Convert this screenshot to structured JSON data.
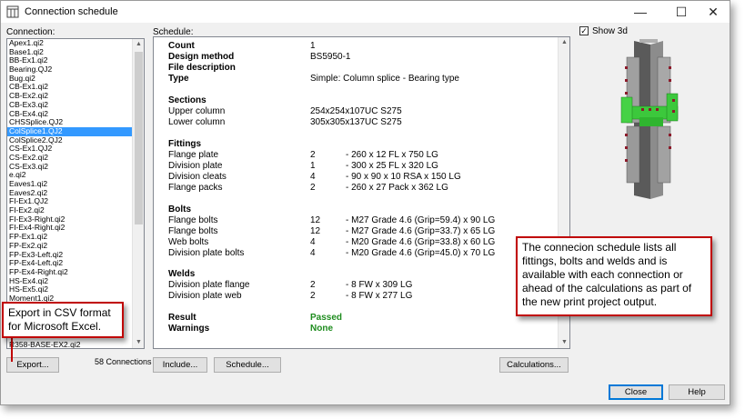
{
  "window": {
    "title": "Connection schedule"
  },
  "titlebar_buttons": {
    "minimize": "—",
    "maximize": "☐",
    "close": "✕"
  },
  "labels": {
    "connection": "Connection:",
    "schedule": "Schedule:",
    "show3d": "Show 3d",
    "connections_count": "58 Connections"
  },
  "connections": [
    "Apex1.qi2",
    "Base1.qi2",
    "BB-Ex1.qi2",
    "Bearing.QJ2",
    "Bug.qi2",
    "CB-Ex1.qi2",
    "CB-Ex2.qi2",
    "CB-Ex3.qi2",
    "CB-Ex4.qi2",
    "CHSSplice.QJ2",
    "ColSplice1.QJ2",
    "ColSplice2.QJ2",
    "CS-Ex1.QJ2",
    "CS-Ex2.qi2",
    "CS-Ex3.qi2",
    "e.qi2",
    "Eaves1.qi2",
    "Eaves2.qi2",
    "FI-Ex1.QJ2",
    "FI-Ex2.qi2",
    "FI-Ex3-Right.qi2",
    "FI-Ex4-Right.qi2",
    "FP-Ex1.qi2",
    "FP-Ex2.qi2",
    "FP-Ex3-Left.qi2",
    "FP-Ex4-Left.qi2",
    "FP-Ex4-Right.qi2",
    "HS-Ex4.qi2",
    "HS-Ex5.qi2",
    "Moment1.qi2"
  ],
  "selected_connection": "ColSplice1.QJ2",
  "last_visible_item": "R358-BASE-EX2.qi2",
  "schedule": {
    "count_label": "Count",
    "count_value": "1",
    "design_method_label": "Design method",
    "design_method_value": "BS5950-1",
    "file_description_label": "File description",
    "type_label": "Type",
    "type_value": "Simple: Column splice - Bearing type",
    "sections_heading": "Sections",
    "upper_column_label": "Upper column",
    "upper_column_value": "254x254x107UC S275",
    "lower_column_label": "Lower column",
    "lower_column_value": "305x305x137UC S275",
    "fittings_heading": "Fittings",
    "fittings": [
      {
        "name": "Flange plate",
        "qty": "2",
        "desc": "- 260 x 12 FL x 750 LG"
      },
      {
        "name": "Division plate",
        "qty": "1",
        "desc": "- 300 x 25 FL x 320 LG"
      },
      {
        "name": "Division cleats",
        "qty": "4",
        "desc": "- 90 x 90 x 10 RSA x 150 LG"
      },
      {
        "name": "Flange packs",
        "qty": "2",
        "desc": "- 260 x 27 Pack x 362 LG"
      }
    ],
    "bolts_heading": "Bolts",
    "bolts": [
      {
        "name": "Flange bolts",
        "qty": "12",
        "desc": "- M27 Grade 4.6 (Grip=59.4)  x 90 LG"
      },
      {
        "name": "Flange bolts",
        "qty": "12",
        "desc": "- M27 Grade 4.6 (Grip=33.7)  x 65 LG"
      },
      {
        "name": "Web bolts",
        "qty": "4",
        "desc": "- M20 Grade 4.6 (Grip=33.8)  x 60 LG"
      },
      {
        "name": "Division plate bolts",
        "qty": "4",
        "desc": "- M20 Grade 4.6 (Grip=45.0)  x 70 LG"
      }
    ],
    "welds_heading": "Welds",
    "welds": [
      {
        "name": "Division plate flange",
        "qty": "2",
        "desc": "- 8 FW x 309 LG"
      },
      {
        "name": "Division plate web",
        "qty": "2",
        "desc": "- 8 FW x 277 LG"
      }
    ],
    "result_label": "Result",
    "result_value": "Passed",
    "warnings_label": "Warnings",
    "warnings_value": "None"
  },
  "buttons": {
    "export": "Export...",
    "include": "Include...",
    "schedule": "Schedule...",
    "calculations": "Calculations...",
    "close": "Close",
    "help": "Help"
  },
  "callouts": {
    "export": "Export in CSV format for Microsoft Excel.",
    "schedule": "The connecion schedule lists all fittings, bolts and welds and is available with each connection or ahead of the calculations as part of the new print project output."
  },
  "colors": {
    "selection": "#3399ff",
    "passed": "#1e8c1e",
    "callout_border": "#c00000",
    "model_green": "#3cc83c",
    "model_steel": "#6e6e6e"
  }
}
